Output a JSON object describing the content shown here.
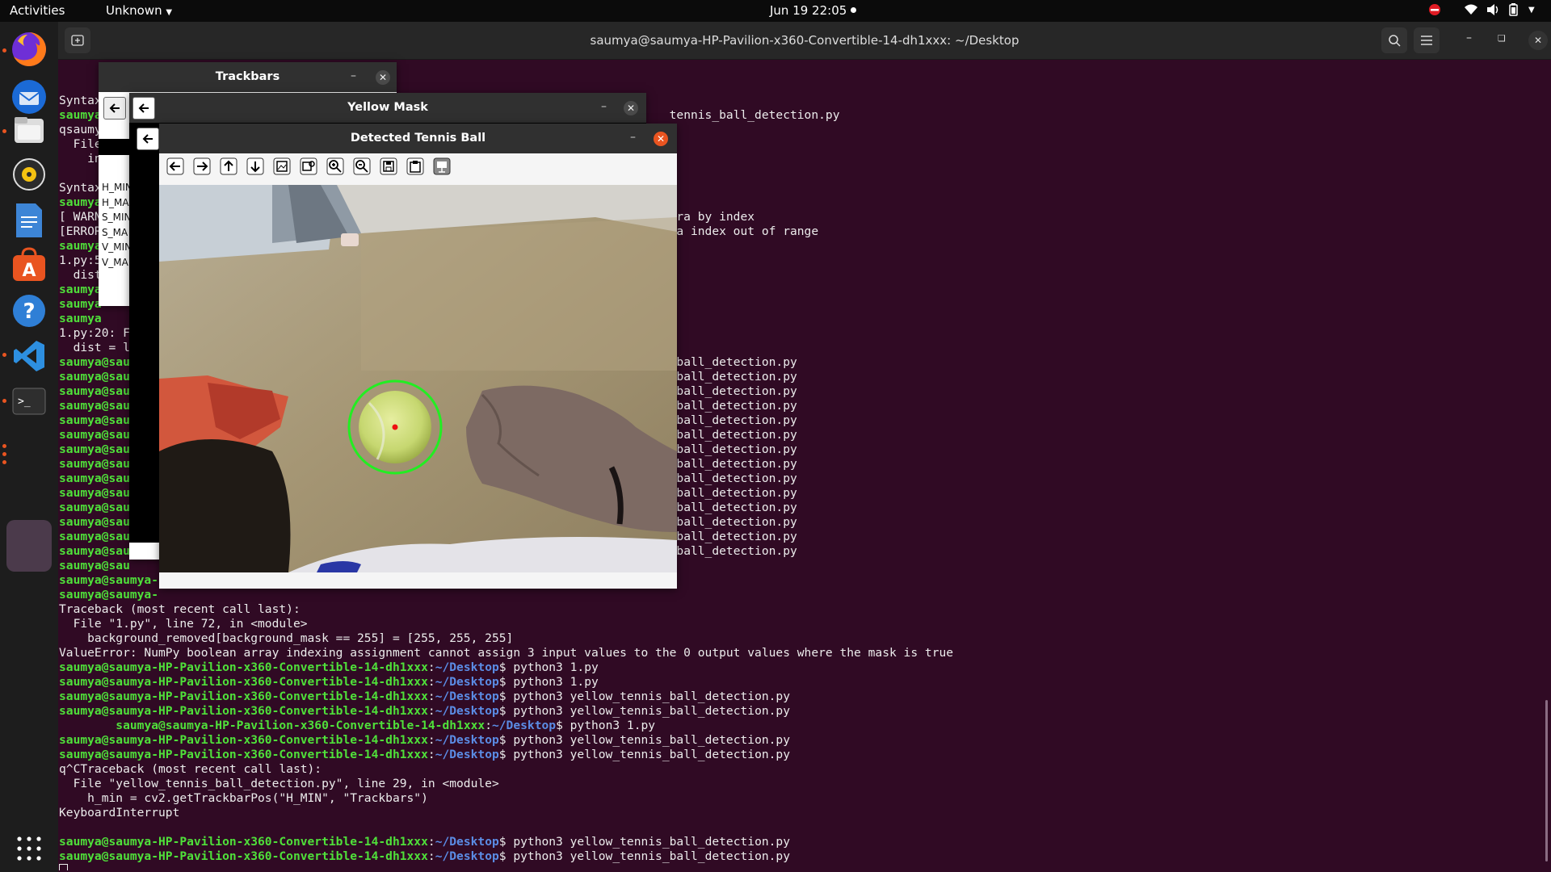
{
  "topbar": {
    "activities": "Activities",
    "app_menu": "Unknown",
    "clock": "Jun 19  22:05"
  },
  "dock": {
    "apps": [
      "firefox-icon",
      "thunderbird-icon",
      "files-icon",
      "rhythmbox-icon",
      "libreoffice-writer-icon",
      "ubuntu-software-icon",
      "help-icon",
      "vscode-icon",
      "terminal-icon",
      "active-window-icon",
      "show-apps-icon"
    ]
  },
  "terminal": {
    "title": "saumya@saumya-HP-Pavilion-x360-Convertible-14-dh1xxx: ~/Desktop",
    "prompt_user": "saumya@saumya-HP-Pavilion-x360-Convertible-14-dh1xxx",
    "prompt_path": "~/Desktop",
    "lines_top": [
      "",
      "Syntax",
      "saumya@s",
      "qsaumya",
      "  File",
      "    in",
      "",
      "Syntax",
      "saumya",
      "[ WARN",
      "[ERROR",
      "saumya",
      "1.py:5",
      "  dist",
      "saumya",
      "saumya",
      "saumya",
      "1.py:20: F",
      "  dist = l"
    ],
    "right_fragments": {
      "r1": "tennis_ball_detection.py",
      "r2": "era by index",
      "r3": "ra index out of range",
      "r_ball": "_ball_detection.py"
    },
    "partial_prompt": "saumya@sau",
    "partial_prompt_long": "saumya@saumya-",
    "traceback1": [
      "Traceback (most recent call last):",
      "  File \"1.py\", line 72, in <module>",
      "    background_removed[background_mask == 255] = [255, 255, 255]",
      "ValueError: NumPy boolean array indexing assignment cannot assign 3 input values to the 0 output values where the mask is true"
    ],
    "cmds": [
      "$ python3 1.py",
      "$ python3 1.py",
      "$ python3 yellow_tennis_ball_detection.py",
      "$ python3 yellow_tennis_ball_detection.py",
      "$ python3 1.py",
      "$ python3 yellow_tennis_ball_detection.py",
      "$ python3 yellow_tennis_ball_detection.py"
    ],
    "traceback2": [
      "q^CTraceback (most recent call last):",
      "  File \"yellow_tennis_ball_detection.py\", line 29, in <module>",
      "    h_min = cv2.getTrackbarPos(\"H_MIN\", \"Trackbars\")",
      "KeyboardInterrupt"
    ],
    "final_cmds": [
      "$ python3 yellow_tennis_ball_detection.py",
      "$ python3 yellow_tennis_ball_detection.py"
    ]
  },
  "windows": {
    "trackbars": {
      "title": "Trackbars",
      "labels": [
        "H_MIN",
        "H_MA",
        "S_MIN",
        "S_MA",
        "V_MIN",
        "V_MA"
      ]
    },
    "yellow_mask": {
      "title": "Yellow Mask"
    },
    "detected": {
      "title": "Detected Tennis Ball",
      "toolbar": [
        "pan-left-icon",
        "pan-right-icon",
        "pan-up-icon",
        "pan-down-icon",
        "zoom-original-icon",
        "zoom-fit-icon",
        "zoom-in-icon",
        "zoom-out-icon",
        "save-icon",
        "copy-clipboard-icon",
        "properties-icon"
      ]
    }
  },
  "colors": {
    "terminal_bg": "#300a24",
    "prompt_user": "#4fe03a",
    "prompt_path": "#5b8de6",
    "accent": "#e95420"
  }
}
